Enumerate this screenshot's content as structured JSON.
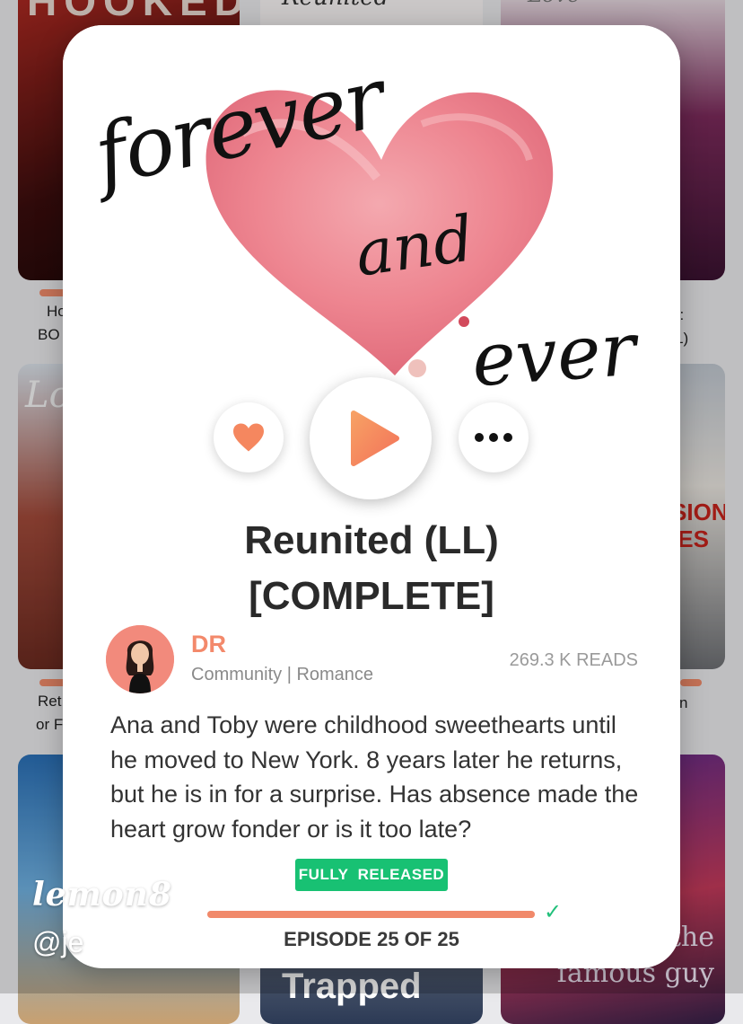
{
  "background": {
    "row1": [
      {
        "cover_text": "HOOKED",
        "title_line1": "Ho",
        "title_line2": "BO"
      },
      {
        "cover_text": "Reunited",
        "title_line1": "",
        "title_line2": ""
      },
      {
        "cover_text": "Love",
        "title_line1": "e:",
        "title_line2": "L)"
      }
    ],
    "row2": [
      {
        "cover_text": "Lo",
        "title_line1": "Ret",
        "title_line2": "or F"
      },
      {
        "cover_text": "",
        "title_line1": "",
        "title_line2": ""
      },
      {
        "cover_text": "SION\nIES",
        "title_line1": "n",
        "title_line2": ""
      }
    ],
    "row3": [
      {
        "cover_text": ""
      },
      {
        "cover_text": "Trapped"
      },
      {
        "cover_text": "the\nfamous guy"
      }
    ]
  },
  "modal": {
    "cover": {
      "script_top": "forever",
      "script_mid": "and",
      "script_bottom": "ever"
    },
    "actions": {
      "like_icon": "heart-icon",
      "play_icon": "play-icon",
      "more_icon": "more-dots-icon"
    },
    "title_line1": "Reunited (LL)",
    "title_line2": "[COMPLETE]",
    "author": {
      "name": "DR",
      "genre": "Community | Romance"
    },
    "reads": "269.3 K READS",
    "description": "Ana and Toby were childhood sweethearts until he moved to New York. 8 years later he returns, but he is in for a surprise. Has absence made the heart grow fonder or is it too late?",
    "status_badge": "FULLY  RELEASED",
    "progress_fraction": 1.0,
    "episode_label": "EPISODE 25 OF 25"
  },
  "watermark": {
    "logo": "lemon8",
    "handle": "@je"
  },
  "colors": {
    "accent": "#f3896b",
    "badge_green": "#18c173",
    "check_green": "#22c07b",
    "heart_pink": "#ec7a86"
  }
}
